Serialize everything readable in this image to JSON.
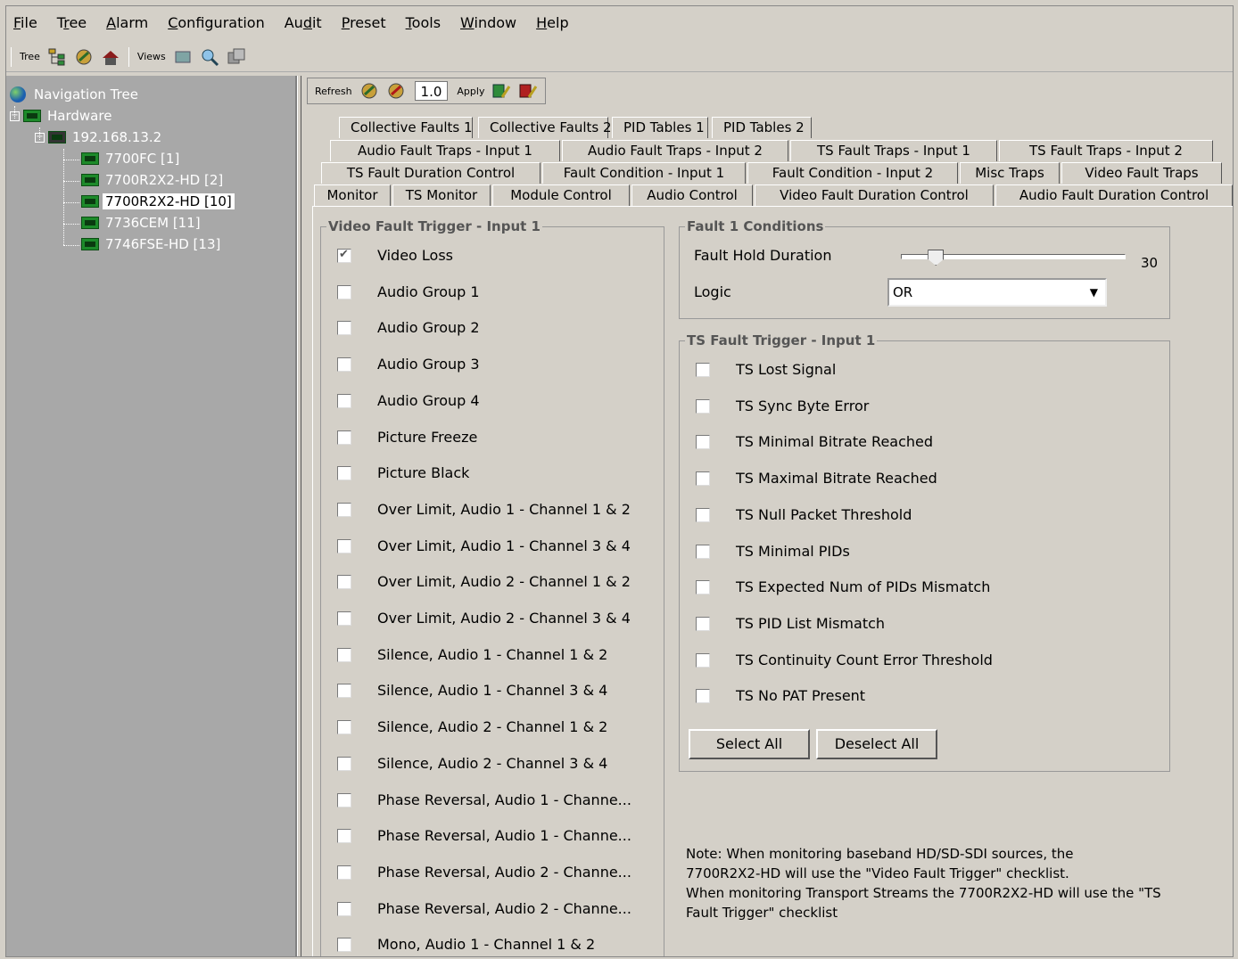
{
  "menu": [
    {
      "pre": "",
      "u": "F",
      "post": "ile"
    },
    {
      "pre": "T",
      "u": "r",
      "post": "ee"
    },
    {
      "pre": "",
      "u": "A",
      "post": "larm"
    },
    {
      "pre": "",
      "u": "C",
      "post": "onfiguration"
    },
    {
      "pre": "Au",
      "u": "d",
      "post": "it"
    },
    {
      "pre": "",
      "u": "P",
      "post": "reset"
    },
    {
      "pre": "",
      "u": "T",
      "post": "ools"
    },
    {
      "pre": "",
      "u": "W",
      "post": "indow"
    },
    {
      "pre": "",
      "u": "H",
      "post": "elp"
    }
  ],
  "toolbar": {
    "tree_label": "Tree",
    "views_label": "Views"
  },
  "tree": {
    "root": "Navigation Tree",
    "hardware": "Hardware",
    "ip": "192.168.13.2",
    "devices": [
      "7700FC [1]",
      "7700R2X2-HD [2]",
      "7700R2X2-HD [10]",
      "7736CEM [11]",
      "7746FSE-HD [13]"
    ],
    "selected_index": 2
  },
  "panel_toolbar": {
    "refresh": "Refresh",
    "value": "1.0",
    "apply": "Apply"
  },
  "tabs": {
    "row1": [
      "Collective Faults 1",
      "Collective Faults 2",
      "PID Tables 1",
      "PID Tables 2"
    ],
    "row2": [
      "Audio Fault Traps - Input 1",
      "Audio Fault Traps - Input 2",
      "TS Fault Traps - Input 1",
      "TS Fault Traps - Input 2"
    ],
    "row3": [
      "TS Fault Duration Control",
      "Fault Condition - Input 1",
      "Fault Condition - Input 2",
      "Misc Traps",
      "Video Fault Traps"
    ],
    "row4": [
      "Monitor",
      "TS Monitor",
      "Module Control",
      "Audio Control",
      "Video Fault Duration Control",
      "Audio Fault Duration Control"
    ],
    "active": "Fault Condition - Input 1"
  },
  "video_trigger": {
    "title": "Video Fault Trigger - Input 1",
    "items": [
      {
        "label": "Video Loss",
        "checked": true
      },
      {
        "label": "Audio Group 1",
        "checked": false
      },
      {
        "label": "Audio Group 2",
        "checked": false
      },
      {
        "label": "Audio Group 3",
        "checked": false
      },
      {
        "label": "Audio Group 4",
        "checked": false
      },
      {
        "label": "Picture Freeze",
        "checked": false
      },
      {
        "label": "Picture Black",
        "checked": false
      },
      {
        "label": "Over Limit, Audio 1 - Channel 1 & 2",
        "checked": false
      },
      {
        "label": "Over Limit, Audio 1 - Channel 3 & 4",
        "checked": false
      },
      {
        "label": "Over Limit, Audio 2 - Channel 1 & 2",
        "checked": false
      },
      {
        "label": "Over Limit, Audio 2 - Channel 3 & 4",
        "checked": false
      },
      {
        "label": "Silence, Audio 1 - Channel 1 & 2",
        "checked": false
      },
      {
        "label": "Silence, Audio 1 - Channel 3 & 4",
        "checked": false
      },
      {
        "label": "Silence, Audio 2 - Channel 1 & 2",
        "checked": false
      },
      {
        "label": "Silence, Audio 2 - Channel 3 & 4",
        "checked": false
      },
      {
        "label": "Phase Reversal, Audio 1 - Channe...",
        "checked": false
      },
      {
        "label": "Phase Reversal, Audio 1 - Channe...",
        "checked": false
      },
      {
        "label": "Phase Reversal, Audio 2 - Channe...",
        "checked": false
      },
      {
        "label": "Phase Reversal, Audio 2 - Channe...",
        "checked": false
      },
      {
        "label": "Mono, Audio 1 - Channel 1 & 2",
        "checked": false
      }
    ]
  },
  "fault_conditions": {
    "title": "Fault 1 Conditions",
    "hold_label": "Fault Hold Duration",
    "hold_value": "30",
    "hold_fraction": 0.12,
    "logic_label": "Logic",
    "logic_value": "OR"
  },
  "ts_trigger": {
    "title": "TS Fault Trigger - Input 1",
    "items": [
      {
        "label": "TS Lost Signal",
        "checked": false
      },
      {
        "label": "TS Sync Byte Error",
        "checked": false
      },
      {
        "label": "TS Minimal Bitrate Reached",
        "checked": false
      },
      {
        "label": "TS Maximal Bitrate Reached",
        "checked": false
      },
      {
        "label": "TS Null Packet Threshold",
        "checked": false
      },
      {
        "label": "TS Minimal PIDs",
        "checked": false
      },
      {
        "label": "TS Expected Num of PIDs Mismatch",
        "checked": false
      },
      {
        "label": "TS PID List Mismatch",
        "checked": false
      },
      {
        "label": "TS Continuity Count Error Threshold",
        "checked": false
      },
      {
        "label": "TS No PAT Present",
        "checked": false
      }
    ],
    "select_all": "Select All",
    "deselect_all": "Deselect All"
  },
  "note": [
    "Note: When monitoring baseband HD/SD-SDI sources, the",
    "7700R2X2-HD will use the \"Video Fault Trigger\" checklist.",
    "When monitoring Transport Streams the 7700R2X2-HD will use the \"TS",
    "Fault Trigger\" checklist"
  ]
}
